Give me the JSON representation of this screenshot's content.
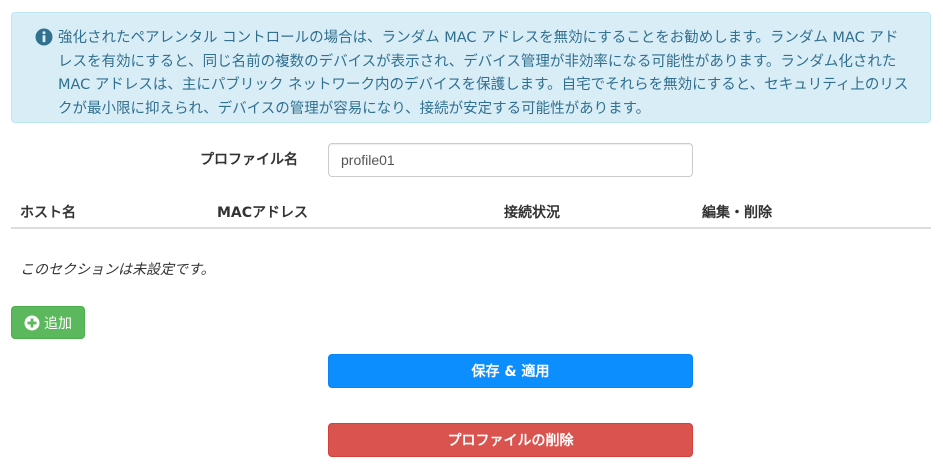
{
  "info": {
    "icon": "info-circle-icon",
    "text": "強化されたペアレンタル コントロールの場合は、ランダム MAC アドレスを無効にすることをお勧めします。ランダム MAC アドレスを有効にすると、同じ名前の複数のデバイスが表示され、デバイス管理が非効率になる可能性があります。ランダム化された MAC アドレスは、主にパブリック ネットワーク内のデバイスを保護します。自宅でそれらを無効にすると、セキュリティ上のリスクが最小限に抑えられ、デバイスの管理が容易になり、接続が安定する可能性があります。"
  },
  "profile": {
    "label": "プロファイル名",
    "value": "profile01"
  },
  "table": {
    "headers": {
      "host": "ホスト名",
      "mac": "MACアドレス",
      "status": "接続状況",
      "edit": "編集・削除"
    },
    "empty_text": "このセクションは未設定です。"
  },
  "buttons": {
    "add_label": "追加",
    "add_icon": "plus-circle-icon",
    "save_label": "保存 & 適用",
    "delete_label": "プロファイルの削除"
  },
  "colors": {
    "info_bg": "#d9edf7",
    "info_text": "#31708f",
    "add": "#5cb85c",
    "save": "#0d8eff",
    "delete": "#d9534f"
  }
}
